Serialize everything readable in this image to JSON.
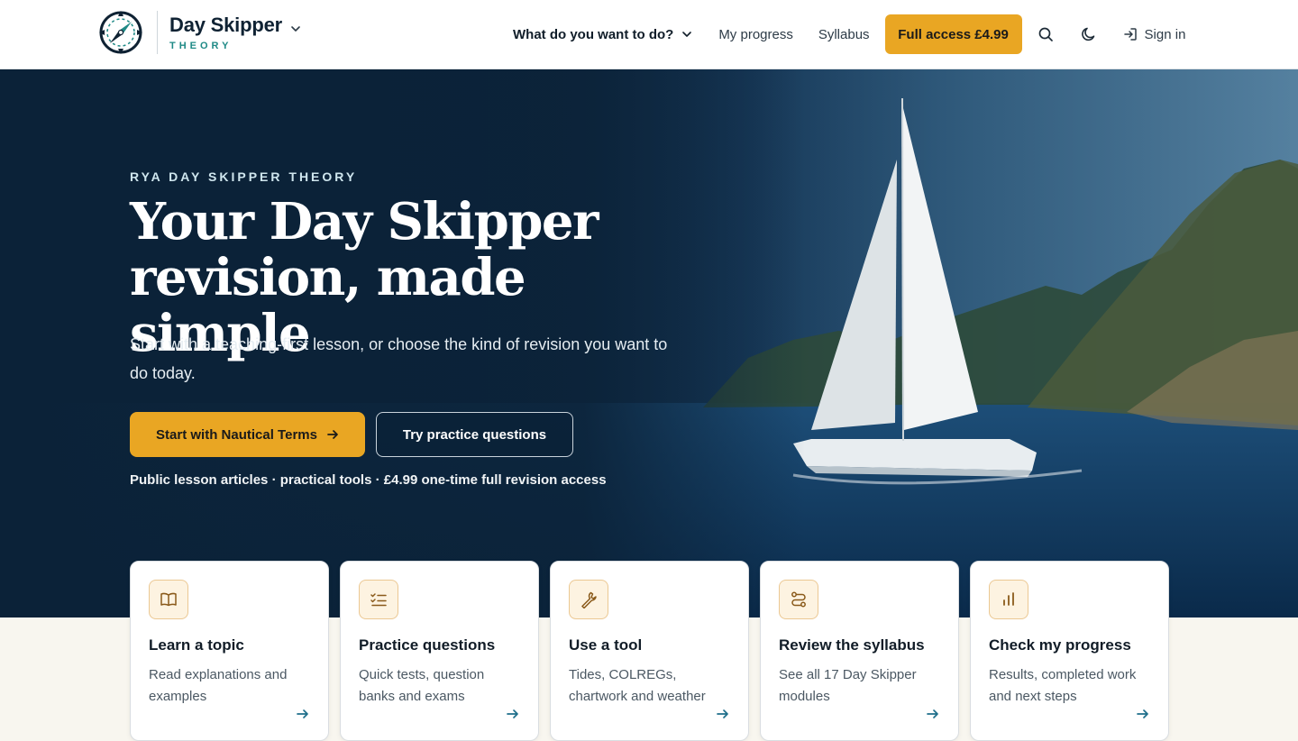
{
  "header": {
    "brand_name": "Day Skipper",
    "brand_sub": "THEORY",
    "nav_what": "What do you want to do?",
    "nav_progress": "My progress",
    "nav_syllabus": "Syllabus",
    "full_access": "Full access £4.99",
    "sign_in": "Sign in"
  },
  "hero": {
    "kicker": "RYA DAY SKIPPER THEORY",
    "title_line1": "Your Day Skipper",
    "title_line2": "revision, made simple",
    "lead": "Start with a teaching-first lesson, or choose the kind of revision you want to do today.",
    "primary_cta": "Start with Nautical Terms",
    "secondary_cta": "Try practice questions",
    "note": "Public lesson articles · practical tools · £4.99 one-time full revision access"
  },
  "cards": [
    {
      "title": "Learn a topic",
      "desc": "Read explanations and examples",
      "icon": "book-icon"
    },
    {
      "title": "Practice questions",
      "desc": "Quick tests, question banks and exams",
      "icon": "checklist-icon"
    },
    {
      "title": "Use a tool",
      "desc": "Tides, COLREGs, chartwork and weather",
      "icon": "wrench-icon"
    },
    {
      "title": "Review the syllabus",
      "desc": "See all 17 Day Skipper modules",
      "icon": "route-icon"
    },
    {
      "title": "Check my progress",
      "desc": "Results, completed work and next steps",
      "icon": "bar-chart-icon"
    }
  ],
  "colors": {
    "accent": "#e9a623",
    "hero_bg": "#0b2238",
    "brand_teal": "#1f8a86",
    "page_bg": "#f8f6ef"
  }
}
